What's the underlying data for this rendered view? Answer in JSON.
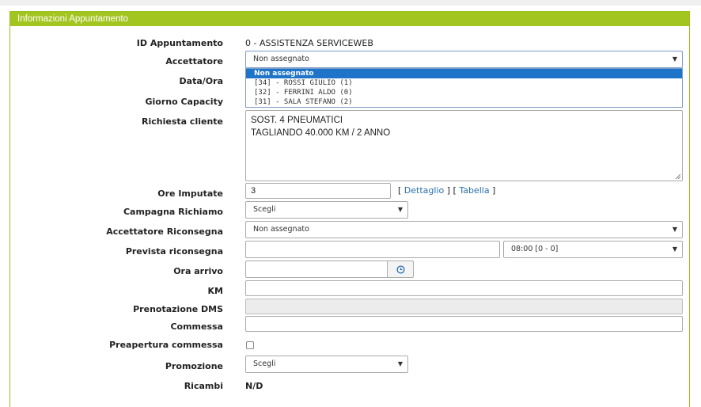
{
  "panel": {
    "title": "Informazioni Appuntamento"
  },
  "fields": {
    "id_appuntamento": {
      "label": "ID Appuntamento",
      "value": "0 - ASSISTENZA SERVICEWEB"
    },
    "accettatore": {
      "label": "Accettatore",
      "selected": "Non assegnato",
      "options": [
        "Non assegnato",
        "[34] - ROSSI GIULIO (1)",
        "[32] - FERRINI ALDO (0)",
        "[31] - SALA STEFANO (2)"
      ]
    },
    "data_ora": {
      "label": "Data/Ora"
    },
    "giorno_capacity": {
      "label": "Giorno Capacity"
    },
    "richiesta_cliente": {
      "label": "Richiesta cliente",
      "lines": [
        "SOST. 4 PNEUMATICI",
        "TAGLIANDO 40.000 KM / 2 ANNO"
      ]
    },
    "ore_imputate": {
      "label": "Ore Imputate",
      "value": "3",
      "link_dettaglio": "Dettaglio",
      "link_tabella": "Tabella"
    },
    "campagna_richiamo": {
      "label": "Campagna Richiamo",
      "selected": "Scegli"
    },
    "accettatore_riconsegna": {
      "label": "Accettatore Riconsegna",
      "selected": "Non assegnato"
    },
    "prevista_riconsegna": {
      "label": "Prevista riconsegna",
      "value": "",
      "time_selected": "08:00 [0 - 0]"
    },
    "ora_arrivo": {
      "label": "Ora arrivo",
      "value": ""
    },
    "km": {
      "label": "KM",
      "value": ""
    },
    "prenotazione_dms": {
      "label": "Prenotazione DMS",
      "value": ""
    },
    "commessa": {
      "label": "Commessa",
      "value": ""
    },
    "preapertura_commessa": {
      "label": "Preapertura commessa",
      "checked": false
    },
    "promozione": {
      "label": "Promozione",
      "selected": "Scegli"
    },
    "ricambi": {
      "label": "Ricambi",
      "value": "N/D"
    }
  },
  "colors": {
    "header": "#a3c520",
    "border": "#9dbf1e",
    "selected_option": "#1e74c9",
    "link": "#2a6fb0"
  }
}
